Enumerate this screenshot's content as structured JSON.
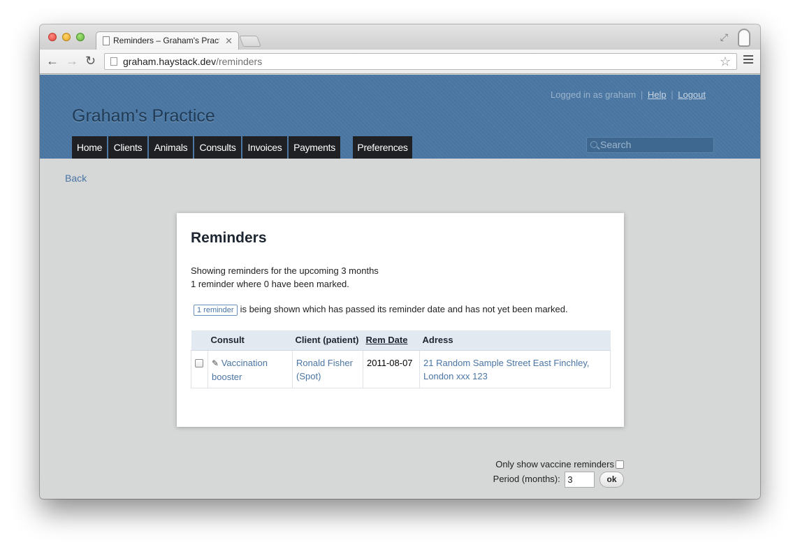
{
  "browser": {
    "tab_title": "Reminders – Graham's Practice",
    "url_host": "graham.haystack.dev",
    "url_path": "/reminders"
  },
  "header": {
    "logged_in_text": "Logged in as graham",
    "help_label": "Help",
    "separator": "|",
    "logout_label": "Logout",
    "brand": "Graham's Practice",
    "search_placeholder": "Search",
    "nav": [
      {
        "label": "Home"
      },
      {
        "label": "Clients"
      },
      {
        "label": "Animals"
      },
      {
        "label": "Consults"
      },
      {
        "label": "Invoices"
      },
      {
        "label": "Payments"
      },
      {
        "label": "Preferences"
      }
    ]
  },
  "page": {
    "back_label": "Back",
    "title": "Reminders",
    "info_line1": "Showing reminders for the upcoming 3 months",
    "info_line2": "1 reminder where 0 have been marked.",
    "badge_label": "1 reminder",
    "shown_text": "is being shown which has passed its reminder date and has not yet been marked."
  },
  "table": {
    "headers": [
      "",
      "Consult",
      "Client (patient)",
      "Rem Date",
      "Adress"
    ],
    "rows": [
      {
        "consult": "Vaccination booster",
        "client": "Ronald Fisher (Spot)",
        "rem_date": "2011-08-07",
        "address": "21 Random Sample Street East Finchley, London xxx 123"
      }
    ]
  },
  "controls": {
    "vaccine_label": "Only show vaccine reminders",
    "period_label": "Period (months):",
    "period_value": "3",
    "ok_label": "ok"
  }
}
